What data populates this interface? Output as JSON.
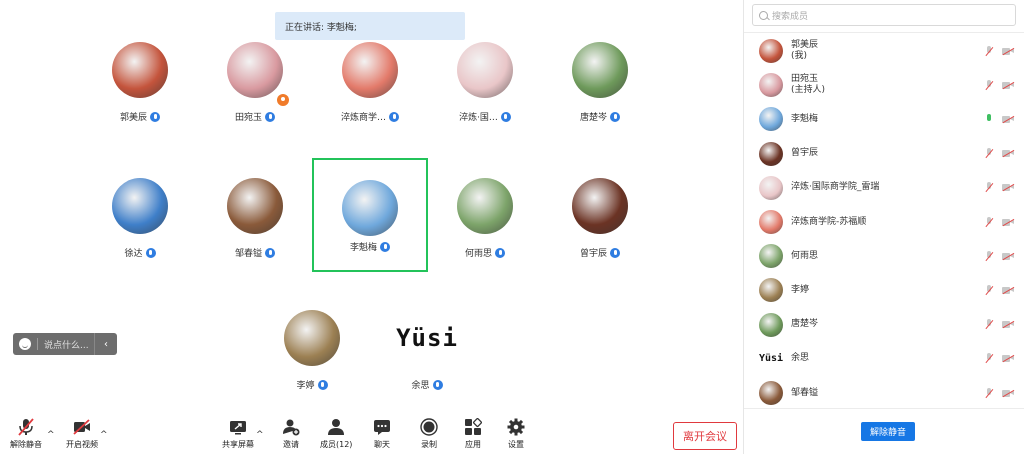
{
  "speaking_banner": "正在讲话: 李魁梅;",
  "tiles": [
    {
      "name": "郭美辰",
      "color": "#c4543c"
    },
    {
      "name": "田宛玉",
      "color": "#d99aa0"
    },
    {
      "name": "淬炼商学…",
      "color": "#e37a6a"
    },
    {
      "name": "淬炼·国…",
      "color": "#e9c6c8"
    },
    {
      "name": "唐楚岑",
      "color": "#6e9a5b"
    },
    {
      "name": "徐达",
      "color": "#3f7fc9"
    },
    {
      "name": "邹春镒",
      "color": "#8a5a3a"
    },
    {
      "name": "李魁梅",
      "color": "#6fa8dc"
    },
    {
      "name": "何雨思",
      "color": "#7da46a"
    },
    {
      "name": "曾宇辰",
      "color": "#6b3324"
    },
    {
      "name": "李婷",
      "color": "#9c8053"
    },
    {
      "name": "余思",
      "logo_text": "Yüsi"
    }
  ],
  "chat_placeholder": "说点什么...",
  "toolbar": {
    "unmute": "解除静音",
    "start_video": "开启视频",
    "share_screen": "共享屏幕",
    "invite": "邀请",
    "members": "成员(12)",
    "chat": "聊天",
    "record": "录制",
    "apps": "应用",
    "settings": "设置",
    "leave": "离开会议"
  },
  "sidebar": {
    "search_placeholder": "搜索成员",
    "members": [
      {
        "name": "郭美辰",
        "sub": "(我)",
        "color": "#c4543c",
        "mic_on": false
      },
      {
        "name": "田宛玉",
        "sub": "(主持人)",
        "color": "#d99aa0",
        "mic_on": false
      },
      {
        "name": "李魁梅",
        "sub": "",
        "color": "#6fa8dc",
        "mic_on": true
      },
      {
        "name": "曾宇辰",
        "sub": "",
        "color": "#6b3324",
        "mic_on": false
      },
      {
        "name": "淬炼·国际商学院_雷瑞",
        "sub": "",
        "color": "#e9c6c8",
        "mic_on": false
      },
      {
        "name": "淬炼商学院-苏福顺",
        "sub": "",
        "color": "#e37a6a",
        "mic_on": false
      },
      {
        "name": "何雨思",
        "sub": "",
        "color": "#7da46a",
        "mic_on": false
      },
      {
        "name": "李婷",
        "sub": "",
        "color": "#9c8053",
        "mic_on": false
      },
      {
        "name": "唐楚岑",
        "sub": "",
        "color": "#6e9a5b",
        "mic_on": false
      },
      {
        "name": "余思",
        "sub": "",
        "logo_text": "Yüsi",
        "mic_on": false
      },
      {
        "name": "邹春镒",
        "sub": "",
        "color": "#8a5a3a",
        "mic_on": false
      }
    ],
    "unmute_all": "解除静音"
  }
}
